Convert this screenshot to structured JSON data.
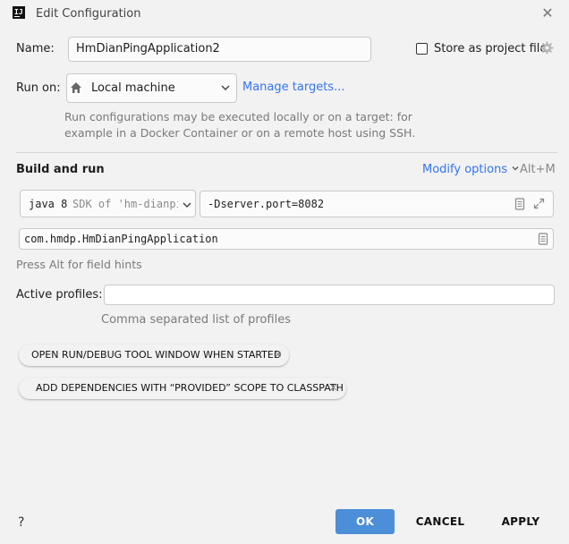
{
  "window": {
    "app_icon_text": "IJ",
    "title": "Edit Configuration",
    "close_icon": "close-icon"
  },
  "name_row": {
    "label": "Name:",
    "value": "HmDianPingApplication2",
    "store_label": "Store as project file",
    "store_checked": false
  },
  "run_on": {
    "label": "Run on:",
    "target": "Local machine",
    "manage_link": "Manage targets...",
    "hint_line1": "Run configurations may be executed locally or on a target: for",
    "hint_line2": "example in a Docker Container or on a remote host using SSH."
  },
  "build_run": {
    "heading": "Build and run",
    "modify_options": "Modify options",
    "shortcut": "Alt+M",
    "jdk_version": "java 8",
    "jdk_detail": "SDK of 'hm-dianping",
    "vm_options": "-Dserver.port=8082",
    "main_class": "com.hmdp.HmDianPingApplication",
    "field_hint": "Press Alt for field hints"
  },
  "profiles": {
    "label": "Active profiles:",
    "value": "",
    "hint": "Comma separated list of profiles"
  },
  "options_chips": [
    {
      "label": "OPEN RUN/DEBUG TOOL WINDOW WHEN STARTED"
    },
    {
      "label": "ADD DEPENDENCIES WITH “PROVIDED” SCOPE TO CLASSPATH"
    }
  ],
  "footer": {
    "help": "?",
    "ok": "OK",
    "cancel": "CANCEL",
    "apply": "APPLY"
  },
  "colors": {
    "accent": "#3574f0",
    "primary_button": "#4d8ed9",
    "background": "#f2f2f2"
  }
}
